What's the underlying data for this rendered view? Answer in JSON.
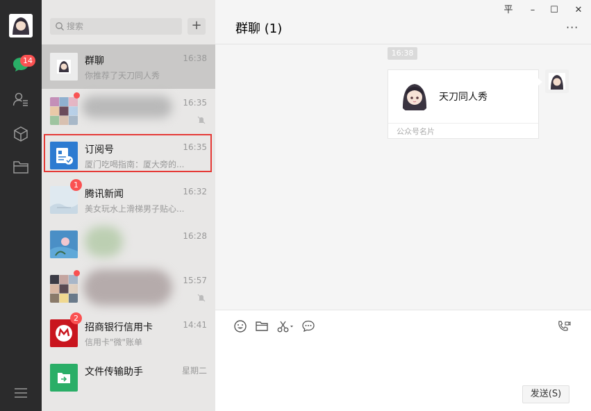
{
  "rail": {
    "badge": "14",
    "icons": [
      "avatar",
      "chat-bubble-icon",
      "contacts-icon",
      "cube-icon",
      "folder-icon",
      "menu-icon"
    ]
  },
  "search": {
    "placeholder": "搜索",
    "add_label": "+"
  },
  "chats": [
    {
      "name": "群聊",
      "time": "16:38",
      "preview": "你推荐了天刀同人秀"
    },
    {
      "name": "",
      "time": "16:35",
      "preview": "",
      "muted": true,
      "dot": true
    },
    {
      "name": "订阅号",
      "time": "16:35",
      "preview": "厦门吃喝指南：厦大旁的..."
    },
    {
      "name": "腾讯新闻",
      "time": "16:32",
      "preview": "美女玩水上滑梯男子贴心...",
      "badge": "1"
    },
    {
      "name": "",
      "time": "16:28",
      "preview": ""
    },
    {
      "name": "",
      "time": "15:57",
      "preview": "",
      "muted": true,
      "dot": true
    },
    {
      "name": "招商银行信用卡",
      "time": "14:41",
      "preview": "信用卡\"微\"账单",
      "badge": "2"
    },
    {
      "name": "文件传输助手",
      "time": "星期二",
      "preview": ""
    }
  ],
  "window": {
    "pin": "平",
    "minimize": "–",
    "maximize": "☐",
    "close": "✕"
  },
  "chat": {
    "title": "群聊 (1)",
    "more": "···",
    "timestamp": "16:38",
    "card": {
      "name": "天刀同人秀",
      "footer": "公众号名片"
    }
  },
  "input": {
    "tools": [
      "emoji-icon",
      "folder-icon",
      "scissors-icon",
      "comment-icon",
      "video-call-icon"
    ],
    "send_label": "发送(S)"
  },
  "colors": {
    "accent_green": "#2aae67",
    "badge_red": "#fa5151",
    "highlight_red": "#e53935",
    "rail": "#2b2b2c"
  }
}
